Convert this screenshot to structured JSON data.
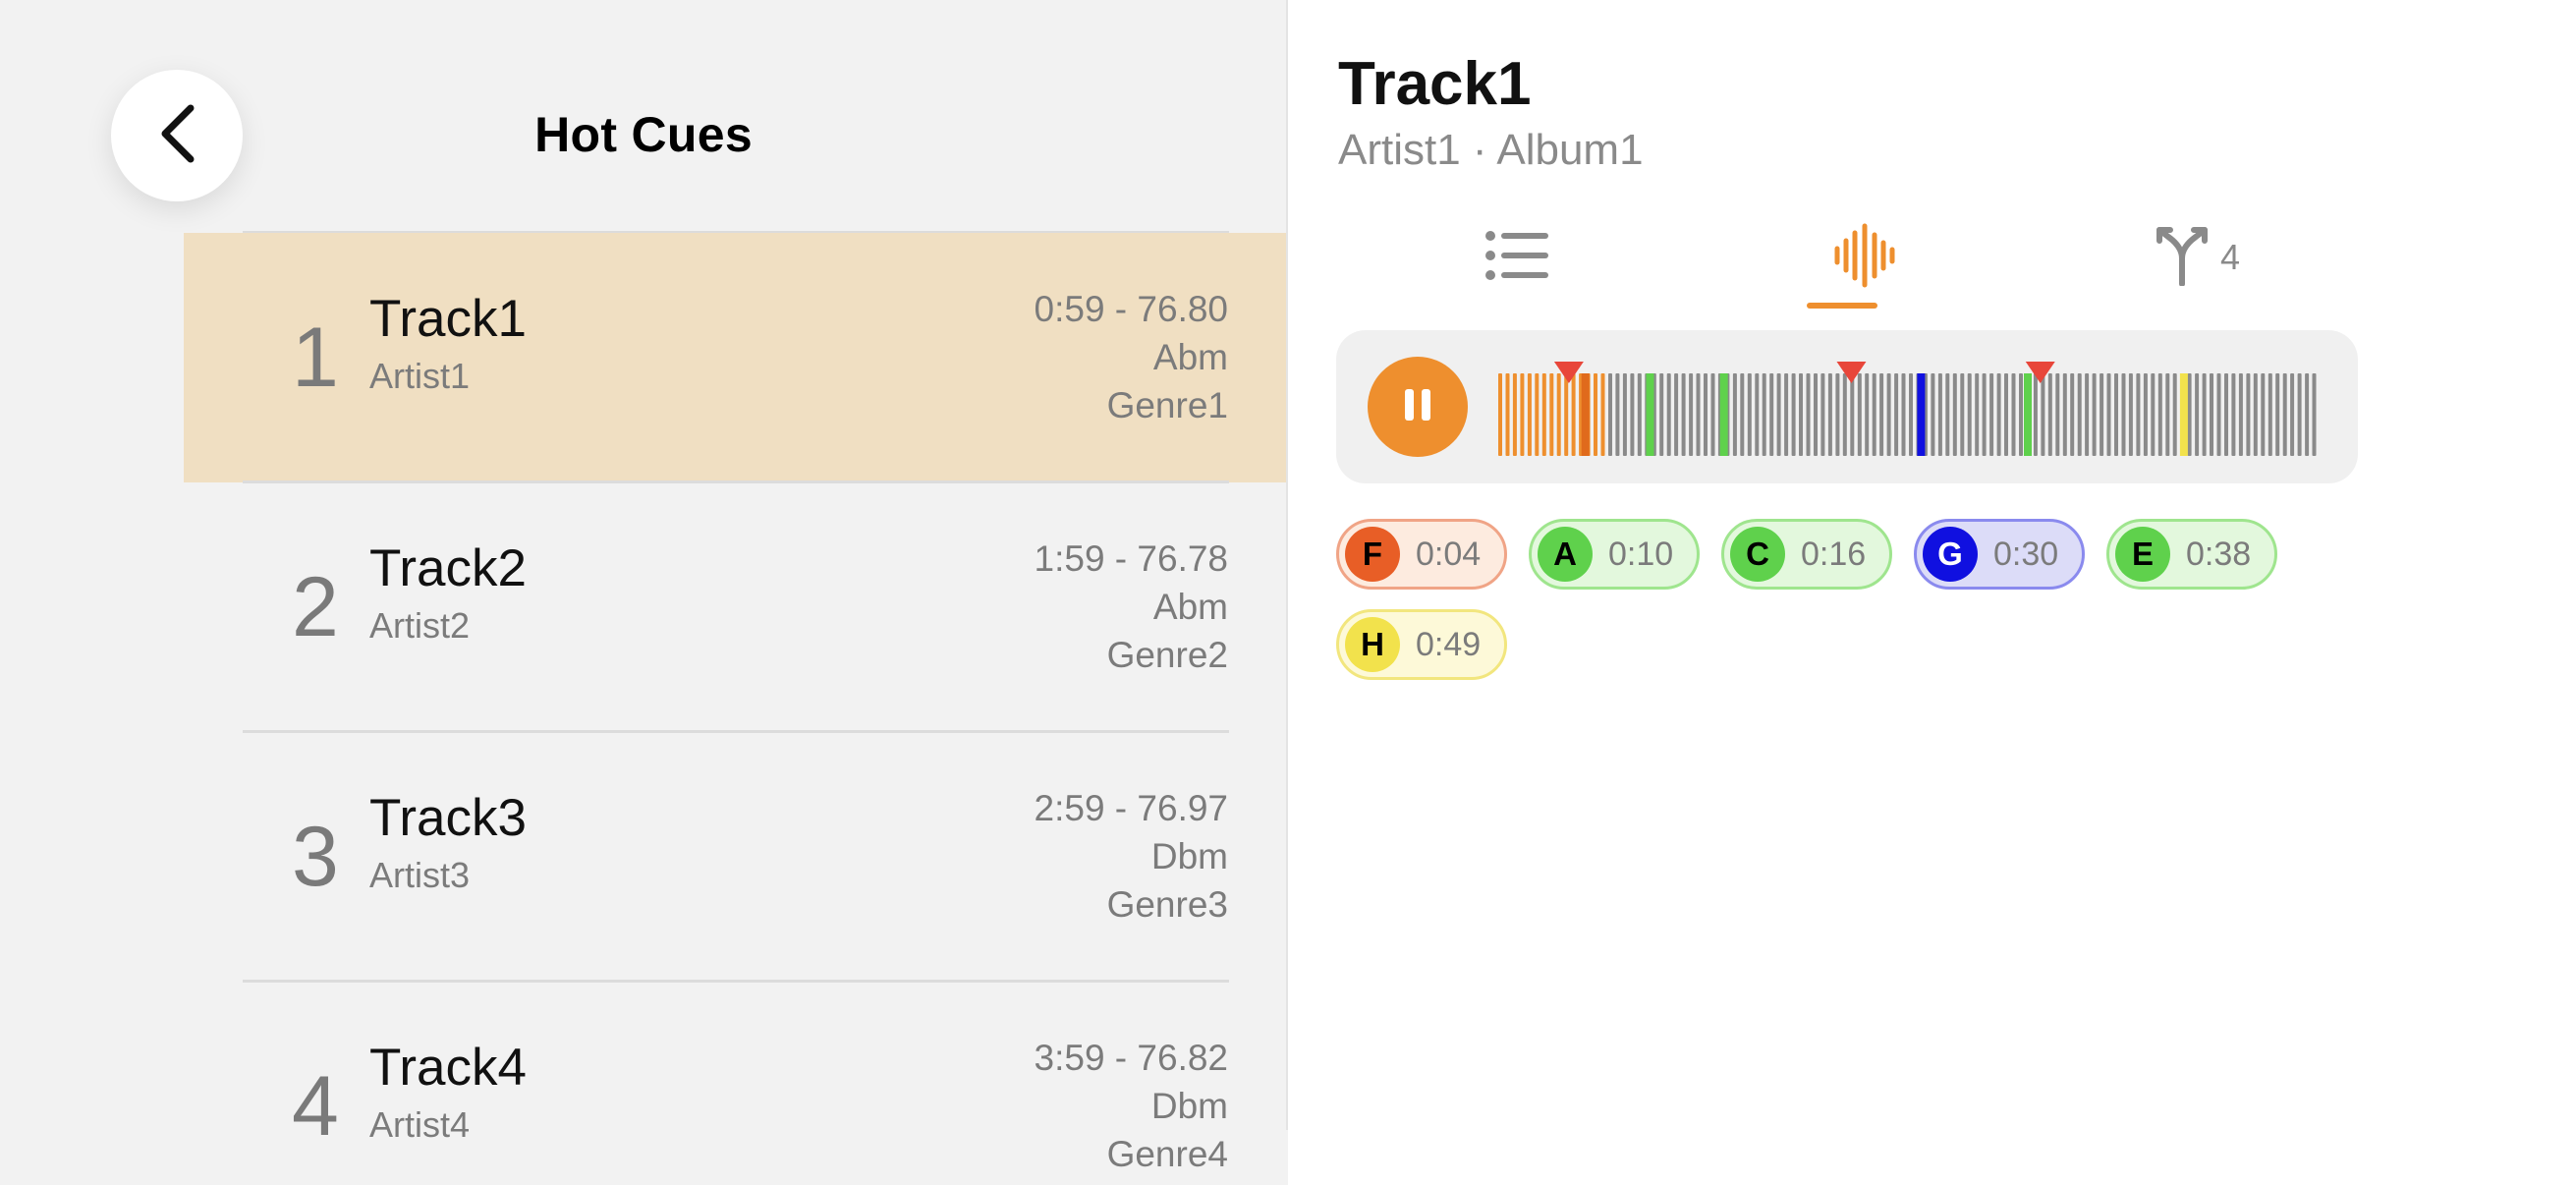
{
  "header": {
    "title": "Hot Cues"
  },
  "tracks": [
    {
      "num": "1",
      "title": "Track1",
      "artist": "Artist1",
      "range": "0:59 - 76.80",
      "key": "Abm",
      "genre": "Genre1"
    },
    {
      "num": "2",
      "title": "Track2",
      "artist": "Artist2",
      "range": "1:59 - 76.78",
      "key": "Abm",
      "genre": "Genre2"
    },
    {
      "num": "3",
      "title": "Track3",
      "artist": "Artist3",
      "range": "2:59 - 76.97",
      "key": "Dbm",
      "genre": "Genre3"
    },
    {
      "num": "4",
      "title": "Track4",
      "artist": "Artist4",
      "range": "3:59 - 76.82",
      "key": "Dbm",
      "genre": "Genre4"
    }
  ],
  "now_playing": {
    "title": "Track1",
    "subtitle": "Artist1 · Album1",
    "tabs": [
      {
        "icon": "list-icon"
      },
      {
        "icon": "waveform-icon",
        "selected": true
      },
      {
        "icon": "branch-icon",
        "count": "4"
      }
    ],
    "play_state": "playing",
    "progress": 0.13,
    "waveform_markers": [
      0.086,
      0.43,
      0.66
    ],
    "waveform_cue_lines": [
      {
        "pos": 0.18,
        "color": "#5fd14c"
      },
      {
        "pos": 0.27,
        "color": "#5fd14c"
      },
      {
        "pos": 0.51,
        "color": "#1010e0"
      },
      {
        "pos": 0.64,
        "color": "#5fd14c"
      },
      {
        "pos": 0.83,
        "color": "#f2e24c"
      }
    ]
  },
  "hot_cues": [
    {
      "letter": "F",
      "time": "0:04",
      "color": "#e85e26",
      "bg": "#fdebdf",
      "border": "#f0a486",
      "text_color": "#000000"
    },
    {
      "letter": "A",
      "time": "0:10",
      "color": "#5fd14c",
      "bg": "#e3f8dd",
      "border": "#9fe58e",
      "text_color": "#000000"
    },
    {
      "letter": "C",
      "time": "0:16",
      "color": "#5fd14c",
      "bg": "#e3f8dd",
      "border": "#9fe58e",
      "text_color": "#000000"
    },
    {
      "letter": "G",
      "time": "0:30",
      "color": "#1010e0",
      "bg": "#dcdcf8",
      "border": "#8a8aee",
      "text_color": "#ffffff"
    },
    {
      "letter": "E",
      "time": "0:38",
      "color": "#5fd14c",
      "bg": "#e3f8dd",
      "border": "#9fe58e",
      "text_color": "#000000"
    },
    {
      "letter": "H",
      "time": "0:49",
      "color": "#f2e24c",
      "bg": "#fdf9d8",
      "border": "#f2e67e",
      "text_color": "#000000"
    }
  ],
  "colors": {
    "accent": "#ee8f2e",
    "active_row": "#f0dfc2",
    "marker": "#e8463a"
  }
}
